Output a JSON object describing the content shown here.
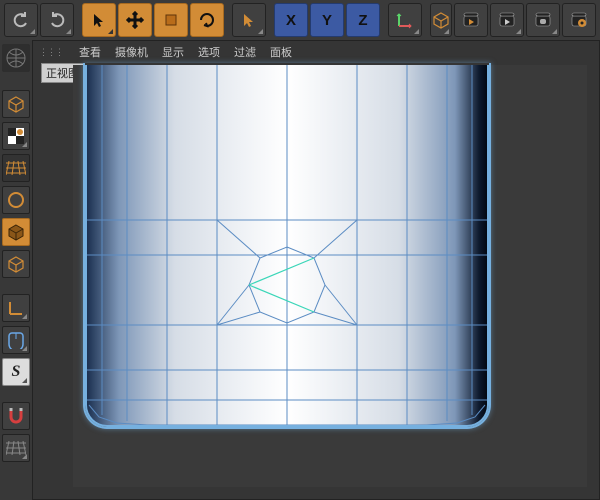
{
  "viewport": {
    "label": "正视图",
    "menu": [
      "查看",
      "摄像机",
      "显示",
      "选项",
      "过滤",
      "面板"
    ]
  },
  "colors": {
    "accent": "#d28c36",
    "selection": "#76b0df",
    "highlight": "#3ad6b8",
    "bg": "#353535"
  },
  "top_toolbar": {
    "history": [
      {
        "name": "undo-button",
        "icon": "undo"
      },
      {
        "name": "redo-button",
        "icon": "redo"
      }
    ],
    "transform": [
      {
        "name": "select-tool",
        "icon": "arrow",
        "selected": true
      },
      {
        "name": "move-tool",
        "icon": "cross",
        "selected": true
      },
      {
        "name": "scale-tool",
        "icon": "box",
        "selected": true
      },
      {
        "name": "rotate-tool",
        "icon": "rot",
        "selected": true
      }
    ],
    "last_tool": {
      "name": "last-tool",
      "icon": "arrow"
    },
    "axes": [
      {
        "name": "lock-x",
        "label": "X",
        "selected": true
      },
      {
        "name": "lock-y",
        "label": "Y",
        "selected": true
      },
      {
        "name": "lock-z",
        "label": "Z",
        "selected": true
      }
    ],
    "coord": {
      "name": "coord-system-button",
      "icon": "Laxis"
    },
    "render": [
      {
        "name": "render-view-button",
        "icon": "render1"
      },
      {
        "name": "render-region-button",
        "icon": "render2"
      },
      {
        "name": "render-pv-button",
        "icon": "render3"
      },
      {
        "name": "render-settings-button",
        "icon": "render-gear"
      }
    ],
    "create": {
      "name": "add-primitive-button",
      "icon": "cube-blue"
    }
  },
  "left_toolbar_history": [
    {
      "name": "undo-side",
      "icon": "undo"
    },
    {
      "name": "redo-side",
      "icon": "redo"
    }
  ],
  "left_toolbar_modes": [
    {
      "name": "globe-icon",
      "icon": "globe",
      "interactable": false
    },
    {
      "name": "make-editable",
      "icon": "cube-solid"
    },
    {
      "name": "texture-mode",
      "icon": "checker"
    },
    {
      "name": "model-mode",
      "icon": "grid-orange"
    },
    {
      "name": "object-mode",
      "icon": "circle-orange"
    },
    {
      "name": "point-mode",
      "icon": "cube-solid-sel",
      "selected": true
    },
    {
      "name": "edge-mode",
      "icon": "cube-wire"
    },
    {
      "name": "sep",
      "icon": "sep"
    },
    {
      "name": "axis-mode",
      "icon": "L-orange"
    },
    {
      "name": "mouse-mode",
      "icon": "mouse"
    },
    {
      "name": "snap-S",
      "icon": "S"
    },
    {
      "name": "sep2",
      "icon": "sep"
    },
    {
      "name": "magnet",
      "icon": "magnet"
    },
    {
      "name": "workplane",
      "icon": "grid-grey"
    }
  ]
}
